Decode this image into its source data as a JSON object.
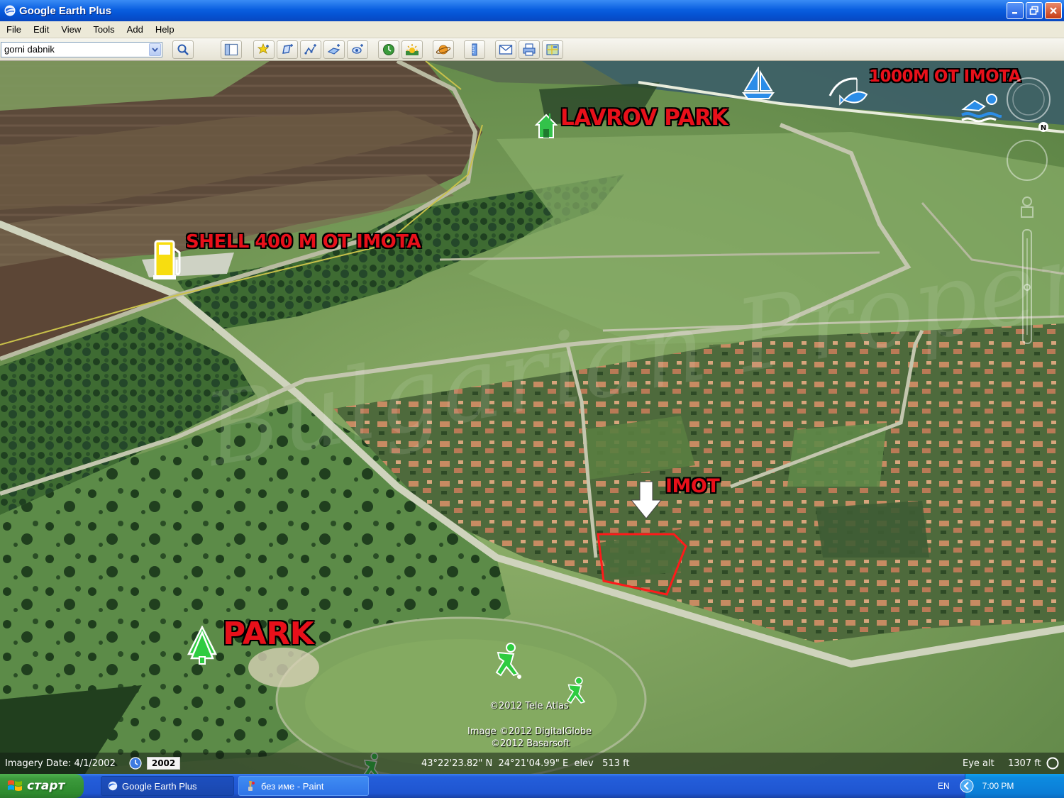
{
  "window": {
    "title": "Google Earth Plus"
  },
  "menu": [
    "File",
    "Edit",
    "View",
    "Tools",
    "Add",
    "Help"
  ],
  "toolbar": {
    "search_value": "gorni dabnik"
  },
  "map": {
    "labels": {
      "lavrov_park": "LAVROV PARK",
      "distance_1000": "1000M OT IMOTA",
      "shell": "SHELL 400 M OT IMOTA",
      "imot": "IMOT",
      "park": "PARK"
    },
    "watermark": "Bulgarian Properties",
    "copyright": {
      "tele_atlas": "©2012 Tele Atlas",
      "digitalglobe": "Image ©2012 DigitalGlobe",
      "basarsoft": "©2012 Basarsoft"
    }
  },
  "statusbar": {
    "imagery_date": "Imagery Date: 4/1/2002",
    "year": "2002",
    "coordinates": "43°22'23.82\" N  24°21'04.99\" E  elev   513 ft",
    "eye_alt_label": "Eye alt",
    "eye_alt_value": "1307 ft"
  },
  "taskbar": {
    "start_label": "старт",
    "tasks": [
      {
        "label": "Google Earth Plus",
        "active": true
      },
      {
        "label": "без име - Paint",
        "active": false
      }
    ],
    "language": "EN",
    "clock": "7:00 PM"
  },
  "colors": {
    "label_red": "#e8101a",
    "marker_green": "#2ecc40",
    "boundary_red": "#ff1a1a"
  }
}
